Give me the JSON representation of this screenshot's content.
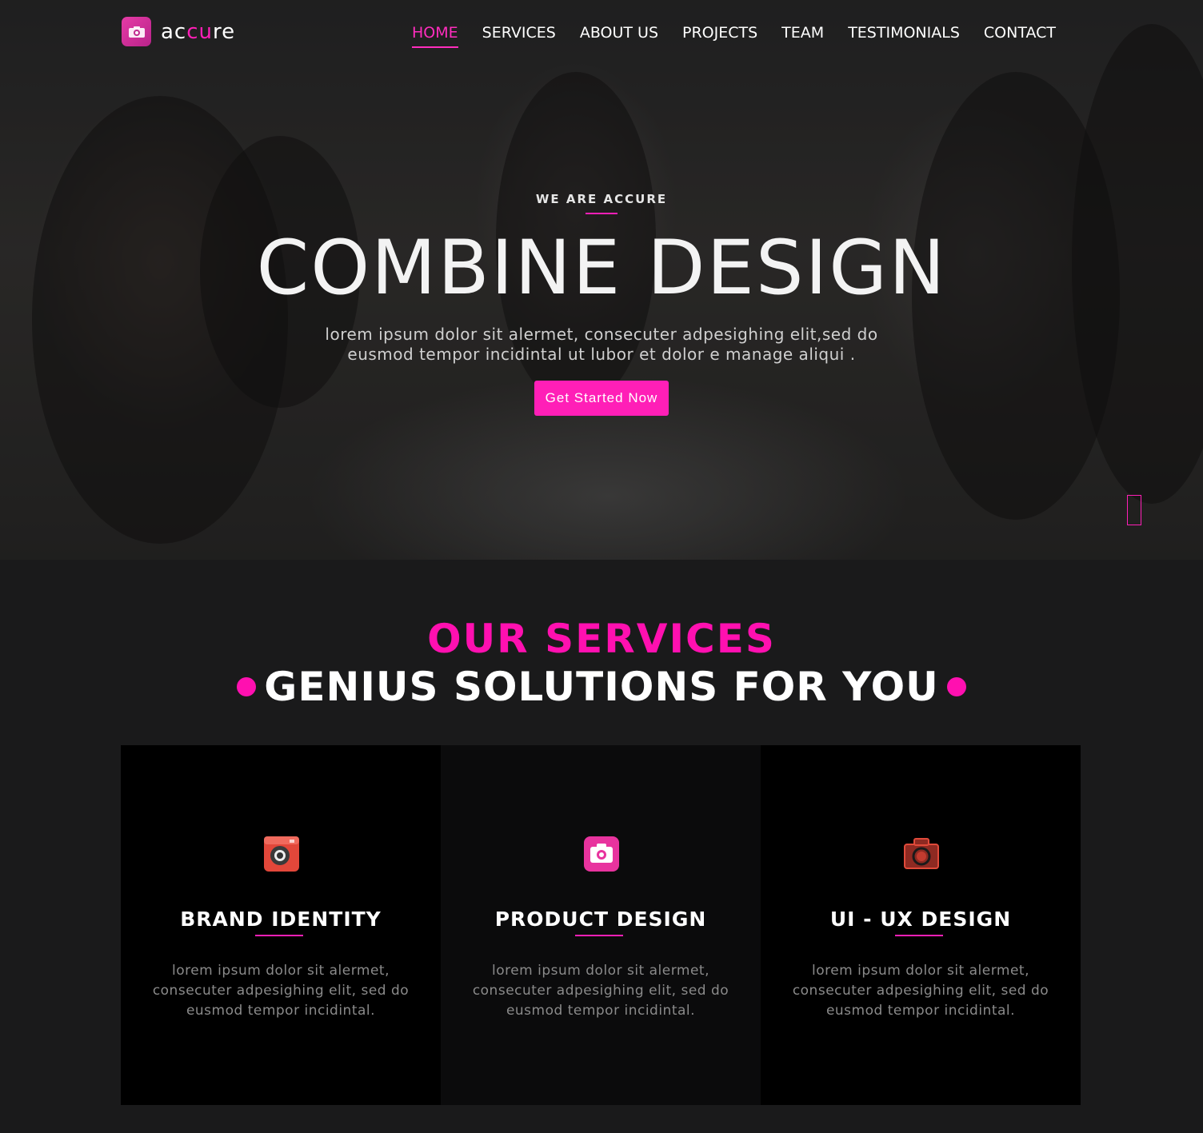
{
  "brand": {
    "prefix": "ac",
    "highlight": "cu",
    "suffix": "re",
    "icon": "camera-icon"
  },
  "nav": {
    "items": [
      {
        "label": "HOME",
        "active": true
      },
      {
        "label": "SERVICES"
      },
      {
        "label": "ABOUT US"
      },
      {
        "label": "PROJECTS"
      },
      {
        "label": "TEAM"
      },
      {
        "label": "TESTIMONIALS"
      },
      {
        "label": "CONTACT"
      }
    ]
  },
  "hero": {
    "eyebrow": "WE ARE ACCURE",
    "title": "COMBINE DESIGN",
    "subtitle": "lorem ipsum dolor sit alermet, consecuter adpesighing elit,sed do eusmod tempor incidintal ut lubor et dolor e manage aliqui .",
    "cta": "Get Started Now",
    "scroll_indicator": "scroll-indicator-icon"
  },
  "services": {
    "title": "OUR SERVICES",
    "subtitle": "GENIUS SOLUTIONS FOR YOU",
    "cards": [
      {
        "title": "BRAND IDENTITY",
        "text": "lorem ipsum dolor sit alermet, consecuter adpesighing elit, sed do eusmod tempor incidintal.",
        "icon": "retro-camera-icon"
      },
      {
        "title": "PRODUCT DESIGN",
        "text": "lorem ipsum dolor sit alermet, consecuter adpesighing elit, sed do eusmod tempor incidintal.",
        "icon": "camera-icon"
      },
      {
        "title": "UI - UX DESIGN",
        "text": "lorem ipsum dolor sit alermet, consecuter adpesighing elit, sed do eusmod tempor incidintal.",
        "icon": "sketch-camera-icon"
      }
    ]
  },
  "colors": {
    "accent": "#ff1fb7",
    "background": "#1a1a1b",
    "card": "#000000"
  }
}
